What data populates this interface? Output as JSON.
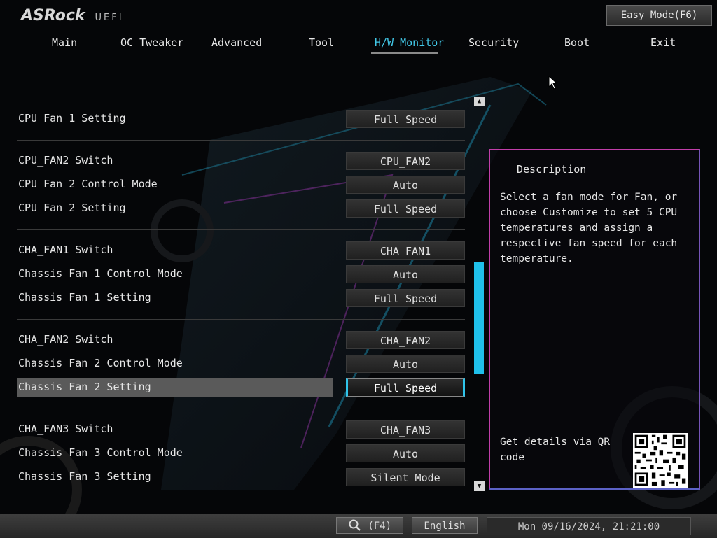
{
  "header": {
    "brand": "ASRock",
    "subtitle": "UEFI",
    "easy_mode_label": "Easy Mode(F6)"
  },
  "tabs": [
    {
      "label": "Main"
    },
    {
      "label": "OC Tweaker"
    },
    {
      "label": "Advanced"
    },
    {
      "label": "Tool"
    },
    {
      "label": "H/W Monitor",
      "active": true
    },
    {
      "label": "Security"
    },
    {
      "label": "Boot"
    },
    {
      "label": "Exit"
    }
  ],
  "settings": [
    {
      "label": "CPU Fan 1 Setting",
      "value": "Full Speed"
    },
    {
      "label": "CPU_FAN2 Switch",
      "value": "CPU_FAN2"
    },
    {
      "label": "CPU Fan 2 Control Mode",
      "value": "Auto"
    },
    {
      "label": "CPU Fan 2 Setting",
      "value": "Full Speed"
    },
    {
      "label": "CHA_FAN1 Switch",
      "value": "CHA_FAN1"
    },
    {
      "label": "Chassis Fan 1 Control Mode",
      "value": "Auto"
    },
    {
      "label": "Chassis Fan 1 Setting",
      "value": "Full Speed"
    },
    {
      "label": "CHA_FAN2 Switch",
      "value": "CHA_FAN2"
    },
    {
      "label": "Chassis Fan 2 Control Mode",
      "value": "Auto"
    },
    {
      "label": "Chassis Fan 2 Setting",
      "value": "Full Speed",
      "selected": true
    },
    {
      "label": "CHA_FAN3 Switch",
      "value": "CHA_FAN3"
    },
    {
      "label": "Chassis Fan 3 Control Mode",
      "value": "Auto"
    },
    {
      "label": "Chassis Fan 3 Setting",
      "value": "Silent Mode"
    }
  ],
  "description": {
    "title": "Description",
    "text": "Select a fan mode for Fan, or choose Customize to set 5 CPU temperatures and assign a respective fan speed for each temperature.",
    "qr_text": "Get details via QR code"
  },
  "footer": {
    "search_label": "(F4)",
    "language": "English",
    "datetime": "Mon 09/16/2024, 21:21:00"
  },
  "colors": {
    "accent": "#1fc0ea",
    "panel_border": "#c23ea9",
    "highlight_row": "#5a5a5a"
  },
  "icons": [
    "search-icon",
    "scroll-up-icon",
    "scroll-down-icon",
    "qr-code-icon",
    "mouse-cursor-icon"
  ]
}
